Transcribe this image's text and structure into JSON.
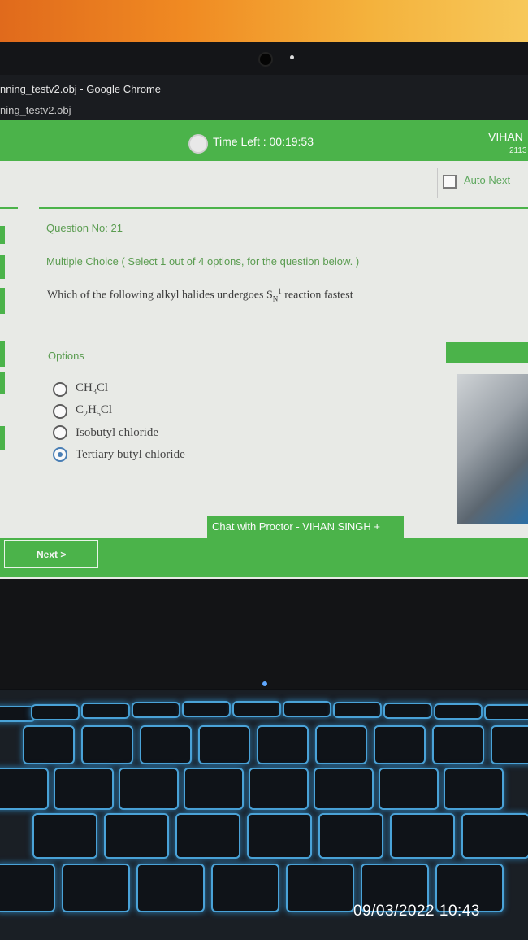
{
  "browser": {
    "window_title": "nning_testv2.obj - Google Chrome",
    "tab_subtitle": "ning_testv2.obj"
  },
  "header": {
    "timer_label": "Time Left : 00:19:53",
    "user_name": "VIHAN",
    "user_id": "2113",
    "auto_next_label": "Auto Next"
  },
  "question": {
    "number_label": "Question No: 21",
    "type_label": "Multiple Choice ( Select 1 out of 4 options, for the question below. )",
    "text_before": "Which of the following alkyl halides undergoes S",
    "text_sub": "N",
    "text_sup": "1",
    "text_after": " reaction fastest"
  },
  "options": {
    "heading": "Options",
    "items": [
      {
        "pre": "CH",
        "sub1": "3",
        "post": "Cl",
        "selected": false
      },
      {
        "pre": "C",
        "sub1": "2",
        "mid": "H",
        "sub2": "5",
        "post": "Cl",
        "selected": false
      },
      {
        "text": "Isobutyl chloride",
        "selected": false
      },
      {
        "text": "Tertiary butyl chloride",
        "selected": true
      }
    ]
  },
  "footer": {
    "chat_label": "Chat with Proctor - VIHAN SINGH  +",
    "next_label": "Next >"
  },
  "photo": {
    "timestamp": "09/03/2022 10:43"
  },
  "colors": {
    "accent_green": "#4bb34a",
    "label_green": "#5a9c50",
    "keyboard_glow": "#4aa3d8"
  }
}
